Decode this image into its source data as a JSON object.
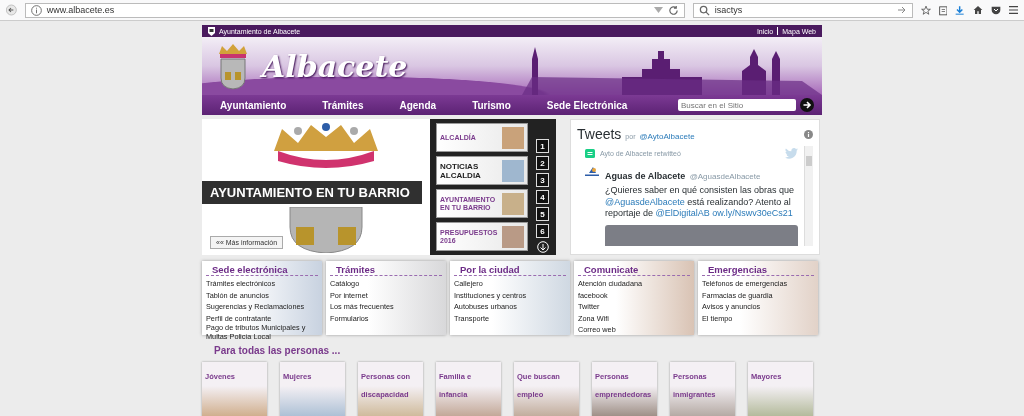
{
  "browser": {
    "url": "www.albacete.es",
    "search": "isactys"
  },
  "topbar": {
    "title": "Ayuntamiento de Albacete",
    "links": [
      "Inicio",
      "Mapa Web"
    ]
  },
  "banner": {
    "logo": "Albacete"
  },
  "nav": {
    "items": [
      "Ayuntamiento",
      "Trámites",
      "Agenda",
      "Turismo",
      "Sede Electrónica"
    ],
    "search_placeholder": "Buscar en el Sitio"
  },
  "slider": {
    "caption": "AYUNTAMIENTO EN TU BARRIO",
    "more": "«« Más información",
    "thumbs": [
      {
        "label": "ALCALDÍA",
        "kind": "caption"
      },
      {
        "label": "NOTICIAS ALCALDIA",
        "kind": "headline"
      },
      {
        "label": "AYUNTAMIENTO EN TU BARRIO",
        "kind": "caption"
      },
      {
        "label": "PRESUPUESTOS 2016",
        "kind": "caption"
      }
    ],
    "pages": [
      "1",
      "2",
      "3",
      "4",
      "5",
      "6"
    ]
  },
  "tweets": {
    "title": "Tweets",
    "by": "por",
    "handle": "@AytoAlbacete",
    "retweet": "Ayto de Albacete retwitteó",
    "author": "Aguas de Albacete",
    "author_handle": "@AguasdeAlbacete",
    "text": [
      {
        "text": "¿Quieres saber en qué consisten las obras que",
        "kind": "plain"
      },
      {
        "text": "@AguasdeAlbacete",
        "kind": "link"
      },
      {
        "text": "está realizando? Atento al reportaje de",
        "kind": "plain"
      },
      {
        "text": "@ElDigitalAB",
        "kind": "link"
      },
      {
        "text": "ow.ly/Nswv30eCs21",
        "kind": "link"
      }
    ]
  },
  "categories": [
    {
      "title": "Sede electrónica",
      "links": [
        "Trámites electrónicos",
        "Tablón de anuncios",
        "Sugerencias y Reclamaciones",
        "Perfil de contratante",
        "Pago de tributos Municipales y Multas Policía Local"
      ]
    },
    {
      "title": "Trámites",
      "links": [
        "Catálogo",
        "Por internet",
        "Los más frecuentes",
        "Formularios"
      ]
    },
    {
      "title": "Por la ciudad",
      "links": [
        "Callejero",
        "Instituciones y centros",
        "Autobuses urbanos",
        "Transporte"
      ]
    },
    {
      "title": "Comunicate",
      "links": [
        "Atención ciudadana",
        "facebook",
        "Twitter",
        "Zona Wifi",
        "Correo web"
      ]
    },
    {
      "title": "Emergencias",
      "links": [
        "Teléfonos de emergencias",
        "Farmacias de guardia",
        "Avisos y anuncios",
        "El tiempo"
      ]
    }
  ],
  "people": {
    "heading": "Para todas las personas ...",
    "groups": [
      "Jóvenes",
      "Mujeres",
      "Personas con discapacidad",
      "Familia e infancia",
      "Que buscan empleo",
      "Personas emprendedoras",
      "Personas inmigrantes",
      "Mayores"
    ]
  }
}
